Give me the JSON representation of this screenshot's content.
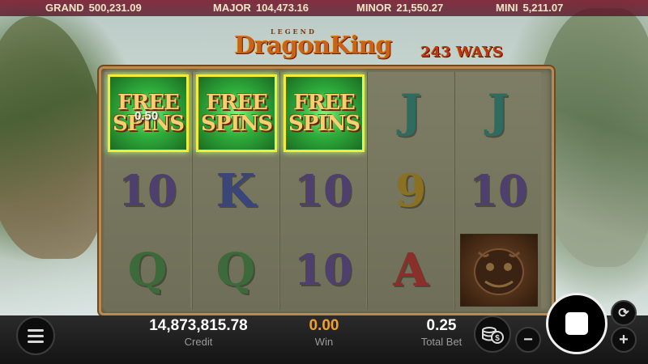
{
  "jackpots": [
    {
      "label": "GRAND",
      "value": "500,231.09"
    },
    {
      "label": "MAJOR",
      "value": "104,473.16"
    },
    {
      "label": "MINOR",
      "value": "21,550.27"
    },
    {
      "label": "MINI",
      "value": "5,211.07"
    }
  ],
  "logo": {
    "legend": "LEGEND",
    "title": "DragonKing",
    "ways": "243 WAYS"
  },
  "reels": {
    "free_spins": {
      "line1": "FREE",
      "line2": "SPINS"
    },
    "win_amount": "0.50",
    "rows": [
      [
        "FREE SPINS",
        "FREE SPINS",
        "FREE SPINS",
        "J",
        "J"
      ],
      [
        "10",
        "K",
        "10",
        "9",
        "10"
      ],
      [
        "Q",
        "Q",
        "10",
        "A",
        "dragon"
      ]
    ]
  },
  "bottom": {
    "credit": {
      "value": "14,873,815.78",
      "label": "Credit"
    },
    "win": {
      "value": "0.00",
      "label": "Win"
    },
    "total_bet": {
      "value": "0.25",
      "label": "Total Bet"
    }
  },
  "colors": {
    "win_value": "#f0a030",
    "highlight": "#f2ec3a",
    "jackpot_bar": "#781428"
  }
}
